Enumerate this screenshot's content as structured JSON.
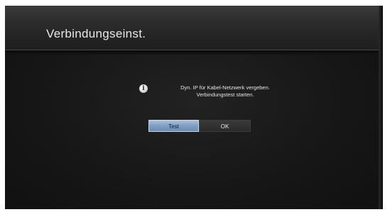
{
  "dialog": {
    "title": "Verbindungseinst.",
    "info_icon": "info-icon",
    "message_line1": "Dyn. IP für Kabel-Netzwerk vergeben.",
    "message_line2": "Verbindungstest starten."
  },
  "buttons": {
    "test_label": "Test",
    "ok_label": "OK",
    "focused": "Test"
  },
  "colors": {
    "background": "#151515",
    "header": "#2e2e2e",
    "focused_button": "#8aa6c8",
    "text": "#e6e6e6"
  }
}
